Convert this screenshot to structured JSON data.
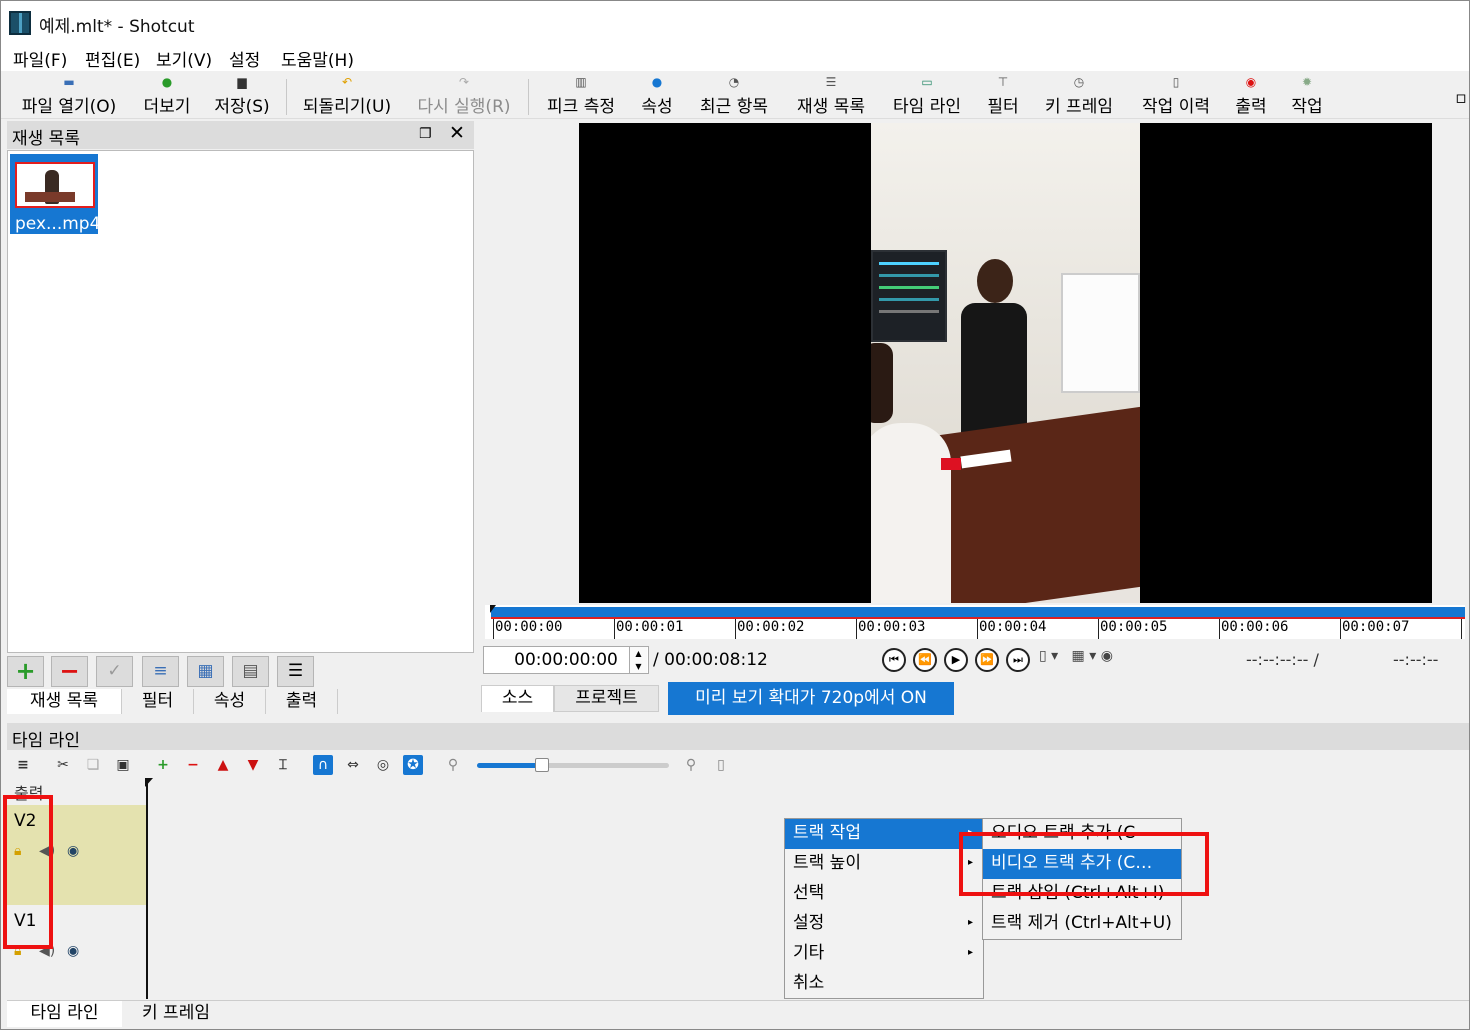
{
  "window": {
    "title": "예제.mlt* - Shotcut"
  },
  "menubar": [
    "파일(F)",
    "편집(E)",
    "보기(V)",
    "설정",
    "도움말(H)"
  ],
  "toolbar": {
    "open": "파일 열기(O)",
    "more": "더보기",
    "save": "저장(S)",
    "undo": "되돌리기(U)",
    "redo": "다시 실행(R)",
    "peak": "피크 측정",
    "properties": "속성",
    "recent": "최근 항목",
    "playlist": "재생 목록",
    "timeline": "타임 라인",
    "filters": "필터",
    "keyframes": "키 프레임",
    "history": "작업 이력",
    "export": "출력",
    "jobs": "작업",
    "overflow": "▫"
  },
  "playlist": {
    "title": "재생 목록",
    "clip_label": "pex...mp4",
    "buttons": [
      "+",
      "−",
      "✓",
      "≡",
      "▦",
      "▤",
      "☰"
    ],
    "tabs": [
      "재생 목록",
      "필터",
      "속성",
      "출력"
    ]
  },
  "player": {
    "ruler_labels": [
      "00:00:00",
      "00:00:01",
      "00:00:02",
      "00:00:03",
      "00:00:04",
      "00:00:05",
      "00:00:06",
      "00:00:07"
    ],
    "timecode": "00:00:00:00",
    "duration": "/ 00:00:08:12",
    "in_point": "--:--:--:-- /",
    "out_point": "--:--:--",
    "tabs": [
      "소스",
      "프로젝트"
    ],
    "zoom_notice": "미리 보기 확대가 720p에서 ON"
  },
  "timeline": {
    "title": "타임 라인",
    "output_label": "출력",
    "tracks": [
      {
        "name": "V2",
        "selected": true
      },
      {
        "name": "V1",
        "selected": false
      }
    ],
    "bottom_tabs": [
      "타임 라인",
      "키 프레임"
    ]
  },
  "context_menu": {
    "items": [
      "트랙 작업",
      "트랙 높이",
      "선택",
      "설정",
      "기타",
      "취소"
    ],
    "active_index": 0,
    "submenu_items": [
      "오디오 트랙 추가 (C",
      "비디오 트랙 추가 (C…",
      "트랙 삽입 (Ctrl+Alt+I)",
      "트랙 제거 (Ctrl+Alt+U)"
    ],
    "submenu_active_index": 1
  },
  "colors": {
    "accent": "#1677d2",
    "highlight_box": "#ee1111",
    "track_selected": "#e4e2af"
  }
}
